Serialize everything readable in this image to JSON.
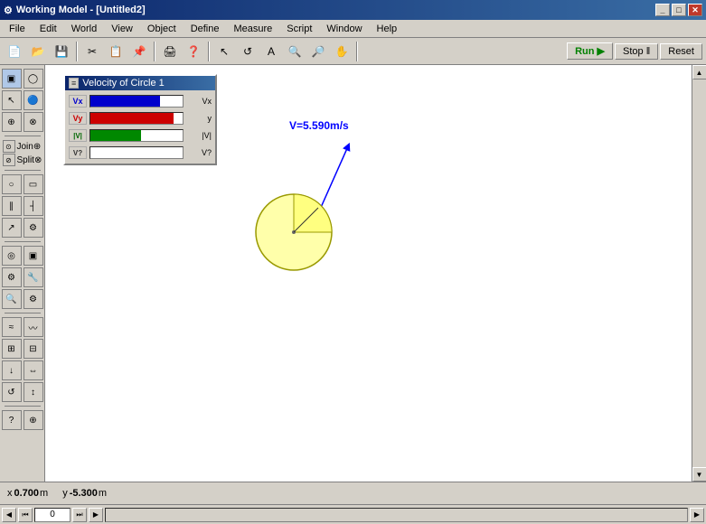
{
  "window": {
    "title": "Working Model - [Untitled2]",
    "title_icon": "⚙"
  },
  "menubar": {
    "items": [
      {
        "label": "File"
      },
      {
        "label": "Edit"
      },
      {
        "label": "World"
      },
      {
        "label": "View"
      },
      {
        "label": "Object"
      },
      {
        "label": "Define"
      },
      {
        "label": "Measure"
      },
      {
        "label": "Script"
      },
      {
        "label": "Window"
      },
      {
        "label": "Help"
      }
    ]
  },
  "toolbar": {
    "run_label": "Run ▶",
    "stop_label": "Stop ‖",
    "reset_label": "Reset"
  },
  "velocity_panel": {
    "title": "Velocity of Circle 1",
    "rows": [
      {
        "label": "Vx",
        "color": "#0000cc",
        "width": 75,
        "value_label": "Vx"
      },
      {
        "label": "Vy",
        "color": "#cc0000",
        "width": 90,
        "value_label": "y"
      },
      {
        "label": "|V|",
        "color": "#008800",
        "width": 55,
        "value_label": "|V|"
      },
      {
        "label": "V?",
        "color": "#888888",
        "width": 0,
        "value_label": "V?"
      }
    ]
  },
  "canvas": {
    "velocity_text": "V=5.590m/s",
    "circle_fill": "#ffffaa",
    "circle_stroke": "#888800"
  },
  "statusbar": {
    "x_label": "x",
    "x_value": "0.700",
    "x_unit": "m",
    "y_label": "y",
    "y_value": "-5.300",
    "y_unit": "m"
  },
  "scrollbar": {
    "frame_value": "0"
  }
}
